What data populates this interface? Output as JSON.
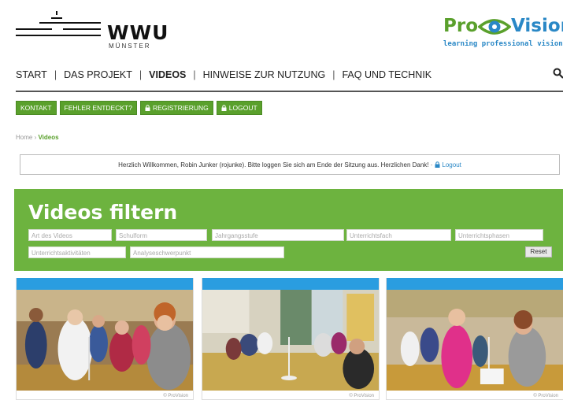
{
  "header": {
    "wwu_name": "WWU",
    "wwu_city": "MÜNSTER",
    "pv_pro": "Pro",
    "pv_vision": "Vision",
    "pv_tagline": "learning professional vision"
  },
  "nav": {
    "items": [
      "START",
      "DAS PROJEKT",
      "VIDEOS",
      "HINWEISE ZUR NUTZUNG",
      "FAQ UND TECHNIK"
    ],
    "active": "VIDEOS",
    "separator": "|"
  },
  "buttons": {
    "kontakt": "KONTAKT",
    "fehler": "FEHLER ENTDECKT?",
    "registrierung": "REGISTRIERUNG",
    "logout": "LOGOUT"
  },
  "breadcrumb": {
    "home": "Home",
    "sep": "›",
    "current": "Videos"
  },
  "welcome": {
    "text": "Herzlich Willkommen, Robin Junker (rojunke). Bitte loggen Sie sich am Ende der Sitzung aus. Herzlichen Dank! ·",
    "logout_link": "Logout"
  },
  "filter": {
    "title": "Videos filtern",
    "fields": {
      "art": "Art des Videos",
      "schulform": "Schulform",
      "jahrgangsstufe": "Jahrgangsstufe",
      "unterrichtsfach": "Unterrichtsfach",
      "unterrichtsphasen": "Unterrichtsphasen",
      "unterrichtsaktivitaeten": "Unterrichtsaktivitäten",
      "analyseschwerpunkt": "Analyseschwerpunkt"
    },
    "reset": "Reset"
  },
  "videos": {
    "credit": "© ProVision"
  },
  "colors": {
    "green": "#6db33f",
    "button_green": "#5aa02c",
    "blue": "#2a9de0"
  }
}
